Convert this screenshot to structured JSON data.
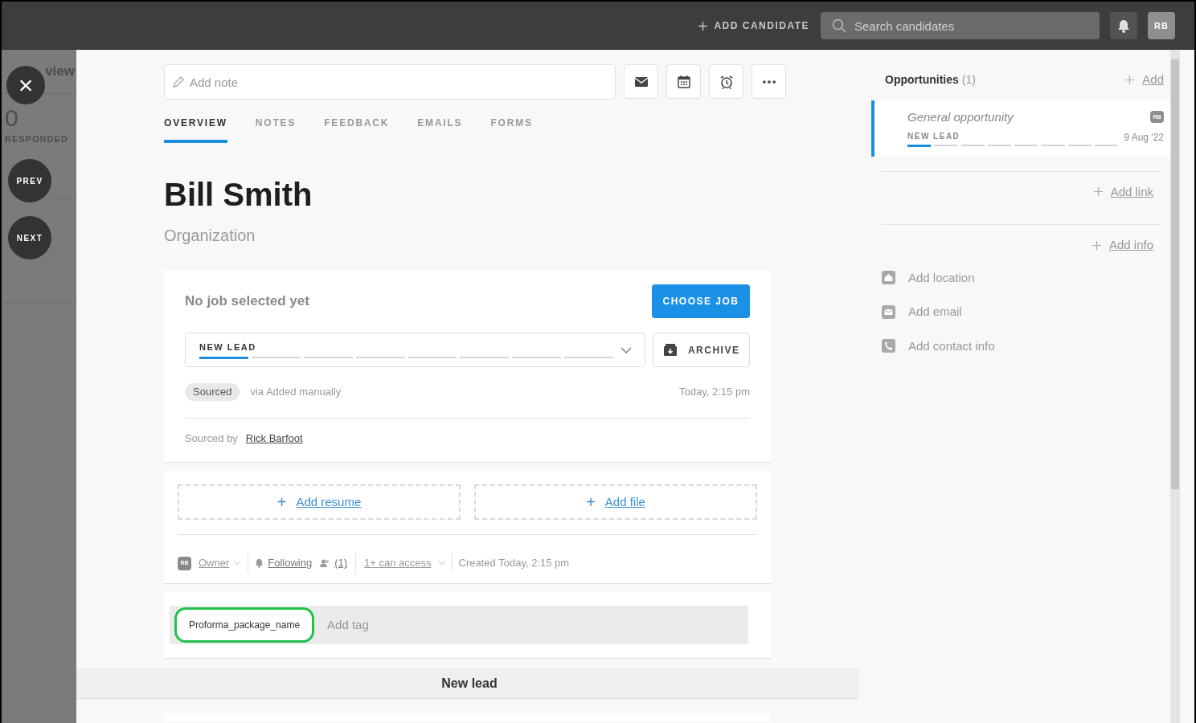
{
  "top_bar": {
    "add_candidate": "ADD CANDIDATE",
    "search": {
      "placeholder": "Search candidates"
    },
    "avatar": "RB"
  },
  "side_strip": {
    "heading": "view",
    "count": "0",
    "count_label": "RESPONDED",
    "buttons": [
      {
        "kind": "close",
        "label": "×"
      },
      {
        "kind": "text",
        "label": "PREV"
      },
      {
        "kind": "text",
        "label": "NEXT"
      }
    ]
  },
  "note": {
    "placeholder": "Add note"
  },
  "toolbar": [
    {
      "kind": "mail"
    },
    {
      "kind": "calendar"
    },
    {
      "kind": "alarm"
    },
    {
      "kind": "more"
    }
  ],
  "tabs": [
    {
      "label": "OVERVIEW",
      "selected": true
    },
    {
      "label": "NOTES",
      "selected": false
    },
    {
      "label": "FEEDBACK",
      "selected": false
    },
    {
      "label": "EMAILS",
      "selected": false
    },
    {
      "label": "FORMS",
      "selected": false
    }
  ],
  "candidate": {
    "name": "Bill Smith",
    "organization": "Organization"
  },
  "job_card": {
    "title": "No job selected yet",
    "choose_button": "CHOOSE JOB",
    "stage": {
      "label": "NEW LEAD",
      "level": 0.125
    },
    "archive_button": "ARCHIVE",
    "source_tag": "Sourced",
    "source_via": "via Added manually",
    "time": "Today, 2:15 pm",
    "sourced_by_label": "Sourced by",
    "sourced_by": "Rick Barfoot"
  },
  "files": [
    {
      "plus": "+",
      "label": "Add resume"
    },
    {
      "plus": "+",
      "label": "Add file"
    }
  ],
  "meta": {
    "owner_avatar": "RB",
    "owner": "Owner",
    "following": "Following",
    "followers": "(1)",
    "access": "1+ can access",
    "created": "Created Today, 2:15 pm"
  },
  "tags": {
    "items": [
      {
        "label": "Proforma_package_name",
        "highlighted": true
      }
    ],
    "placeholder": "Add tag"
  },
  "section_header": "New lead",
  "opportunities": {
    "title": "Opportunities",
    "count": "(1)",
    "add": "Add",
    "items": [
      {
        "name": "General opportunity",
        "avatar": "RB",
        "stage": "NEW LEAD",
        "level": 0.125,
        "date": "9 Aug '22",
        "selected": true
      }
    ]
  },
  "add_link": "Add link",
  "add_info": "Add info",
  "contact_items": [
    {
      "kind": "location",
      "label": "Add location"
    },
    {
      "kind": "email",
      "label": "Add email"
    },
    {
      "kind": "phone",
      "label": "Add contact info"
    }
  ]
}
